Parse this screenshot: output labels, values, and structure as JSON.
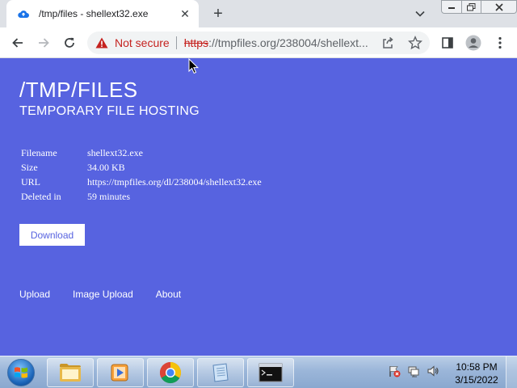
{
  "browser": {
    "tab": {
      "title": "/tmp/files - shellext32.exe",
      "favicon": "cloud-upload-icon",
      "close_glyph": "✕"
    },
    "new_tab_glyph": "+",
    "omnibox": {
      "security_label": "Not secure",
      "url_scheme": "https",
      "url_rest": "://tmpfiles.org/238004/shellext..."
    }
  },
  "page": {
    "title": "/TMP/FILES",
    "subtitle": "TEMPORARY FILE HOSTING",
    "info": [
      {
        "key": "Filename",
        "value": "shellext32.exe"
      },
      {
        "key": "Size",
        "value": "34.00 KB"
      },
      {
        "key": "URL",
        "value": "https://tmpfiles.org/dl/238004/shellext32.exe"
      },
      {
        "key": "Deleted in",
        "value": "59 minutes"
      }
    ],
    "download_label": "Download",
    "footer_links": [
      "Upload",
      "Image Upload",
      "About"
    ],
    "background": "#5763e0"
  },
  "taskbar": {
    "clock_time": "10:58 PM",
    "clock_date": "3/15/2022"
  }
}
